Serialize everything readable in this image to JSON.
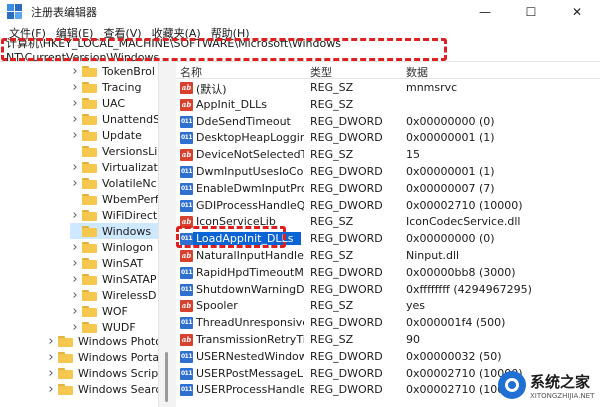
{
  "window": {
    "title": "注册表编辑器",
    "minimize_glyph": "—",
    "maximize_glyph": "☐",
    "close_glyph": "✕"
  },
  "menu": [
    "文件(F)",
    "编辑(E)",
    "查看(V)",
    "收藏夹(A)",
    "帮助(H)"
  ],
  "address": "计算机\\HKEY_LOCAL_MACHINE\\SOFTWARE\\Microsoft\\Windows NT\\CurrentVersion\\Windows",
  "tree": [
    {
      "label": "TokenBrol",
      "expandable": true,
      "selected": false
    },
    {
      "label": "Tracing",
      "expandable": true,
      "selected": false
    },
    {
      "label": "UAC",
      "expandable": true,
      "selected": false
    },
    {
      "label": "UnattendS",
      "expandable": true,
      "selected": false
    },
    {
      "label": "Update",
      "expandable": true,
      "selected": false
    },
    {
      "label": "VersionsLi",
      "expandable": false,
      "selected": false
    },
    {
      "label": "Virtualizati",
      "expandable": true,
      "selected": false
    },
    {
      "label": "VolatileNc",
      "expandable": true,
      "selected": false
    },
    {
      "label": "WbemPerf",
      "expandable": false,
      "selected": false
    },
    {
      "label": "WiFiDirect",
      "expandable": true,
      "selected": false
    },
    {
      "label": "Windows",
      "expandable": false,
      "selected": true
    },
    {
      "label": "Winlogon",
      "expandable": true,
      "selected": false
    },
    {
      "label": "WinSAT",
      "expandable": true,
      "selected": false
    },
    {
      "label": "WinSATAP",
      "expandable": true,
      "selected": false
    },
    {
      "label": "WirelessD",
      "expandable": true,
      "selected": false
    },
    {
      "label": "WOF",
      "expandable": true,
      "selected": false
    },
    {
      "label": "WUDF",
      "expandable": true,
      "selected": false
    },
    {
      "label": "Windows Photo",
      "expandable": true,
      "selected": false
    },
    {
      "label": "Windows Portal",
      "expandable": true,
      "selected": false
    },
    {
      "label": "Windows Script",
      "expandable": true,
      "selected": false
    },
    {
      "label": "Windows Searcl",
      "expandable": true,
      "selected": false
    }
  ],
  "columns": {
    "name": "名称",
    "type": "类型",
    "data": "数据"
  },
  "values": [
    {
      "icon": "ab",
      "name": "(默认)",
      "type": "REG_SZ",
      "data": "mnmsrvc"
    },
    {
      "icon": "ab",
      "name": "AppInit_DLLs",
      "type": "REG_SZ",
      "data": ""
    },
    {
      "icon": "num",
      "name": "DdeSendTimeout",
      "type": "REG_DWORD",
      "data": "0x00000000 (0)"
    },
    {
      "icon": "num",
      "name": "DesktopHeapLogging",
      "type": "REG_DWORD",
      "data": "0x00000001 (1)"
    },
    {
      "icon": "ab",
      "name": "DeviceNotSelectedTi...",
      "type": "REG_SZ",
      "data": "15"
    },
    {
      "icon": "num",
      "name": "DwmInputUsesIoCom...",
      "type": "REG_DWORD",
      "data": "0x00000001 (1)"
    },
    {
      "icon": "num",
      "name": "EnableDwmInputProc...",
      "type": "REG_DWORD",
      "data": "0x00000007 (7)"
    },
    {
      "icon": "num",
      "name": "GDIProcessHandleQu...",
      "type": "REG_DWORD",
      "data": "0x00002710 (10000)"
    },
    {
      "icon": "ab",
      "name": "IconServiceLib",
      "type": "REG_SZ",
      "data": "IconCodecService.dll"
    },
    {
      "icon": "num",
      "name": "LoadAppInit_DLLs",
      "type": "REG_DWORD",
      "data": "0x00000000 (0)",
      "highlight": true
    },
    {
      "icon": "ab",
      "name": "NaturalInputHandler",
      "type": "REG_SZ",
      "data": "Ninput.dll"
    },
    {
      "icon": "num",
      "name": "RapidHpdTimeoutMs",
      "type": "REG_DWORD",
      "data": "0x00000bb8 (3000)"
    },
    {
      "icon": "num",
      "name": "ShutdownWarningDial...",
      "type": "REG_DWORD",
      "data": "0xffffffff (4294967295)"
    },
    {
      "icon": "ab",
      "name": "Spooler",
      "type": "REG_SZ",
      "data": "yes"
    },
    {
      "icon": "num",
      "name": "ThreadUnresponsiveL...",
      "type": "REG_DWORD",
      "data": "0x000001f4 (500)"
    },
    {
      "icon": "ab",
      "name": "TransmissionRetryTim...",
      "type": "REG_SZ",
      "data": "90"
    },
    {
      "icon": "num",
      "name": "USERNestedWindowLi...",
      "type": "REG_DWORD",
      "data": "0x00000032 (50)"
    },
    {
      "icon": "num",
      "name": "USERPostMessageLimit",
      "type": "REG_DWORD",
      "data": "0x00002710 (10000)"
    },
    {
      "icon": "num",
      "name": "USERProcessHandleQ...",
      "type": "REG_DWORD",
      "data": "0x00002710 (10000)"
    }
  ],
  "watermark": {
    "cn": "系统之家",
    "en": "XITONGZHIJIA.NET"
  },
  "colors": {
    "selection": "#0a64d6",
    "annotation": "#e02020",
    "tree_selected": "#cde8ff"
  }
}
